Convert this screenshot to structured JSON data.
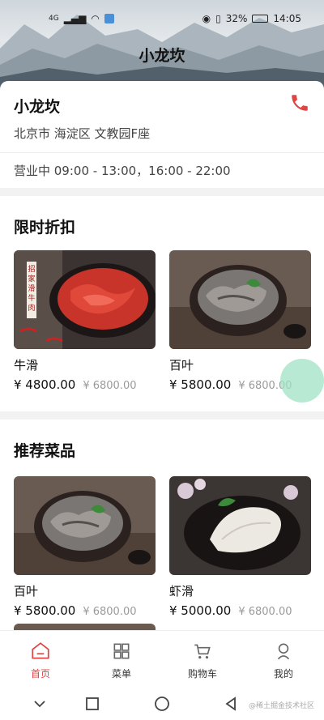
{
  "status": {
    "network": "4G",
    "battery": "32%",
    "time": "14:05"
  },
  "header": {
    "title": "小龙坎"
  },
  "store": {
    "name": "小龙坎",
    "address": "北京市 海淀区 文教园F座",
    "hours": "营业中 09:00 - 13:00，16:00 - 22:00",
    "phone_icon": "phone-icon",
    "accent": "#e04545"
  },
  "discount": {
    "title": "限时折扣",
    "items": [
      {
        "name": "牛滑",
        "price": "¥ 4800.00",
        "old_price": "¥ 6800.00",
        "image": "beef-slices",
        "sign": "招家滑牛肉"
      },
      {
        "name": "百叶",
        "price": "¥ 5800.00",
        "old_price": "¥ 6800.00",
        "image": "tripe"
      }
    ]
  },
  "recommend": {
    "title": "推荐菜品",
    "items": [
      {
        "name": "百叶",
        "price": "¥ 5800.00",
        "old_price": "¥ 6800.00",
        "image": "tripe"
      },
      {
        "name": "虾滑",
        "price": "¥ 5000.00",
        "old_price": "¥ 6800.00",
        "image": "shrimp-paste"
      }
    ]
  },
  "tabs": [
    {
      "label": "首页",
      "icon": "home-icon",
      "active": true
    },
    {
      "label": "菜单",
      "icon": "menu-grid-icon",
      "active": false
    },
    {
      "label": "购物车",
      "icon": "cart-icon",
      "active": false
    },
    {
      "label": "我的",
      "icon": "user-icon",
      "active": false
    }
  ],
  "watermark": "@稀土掘金技术社区"
}
